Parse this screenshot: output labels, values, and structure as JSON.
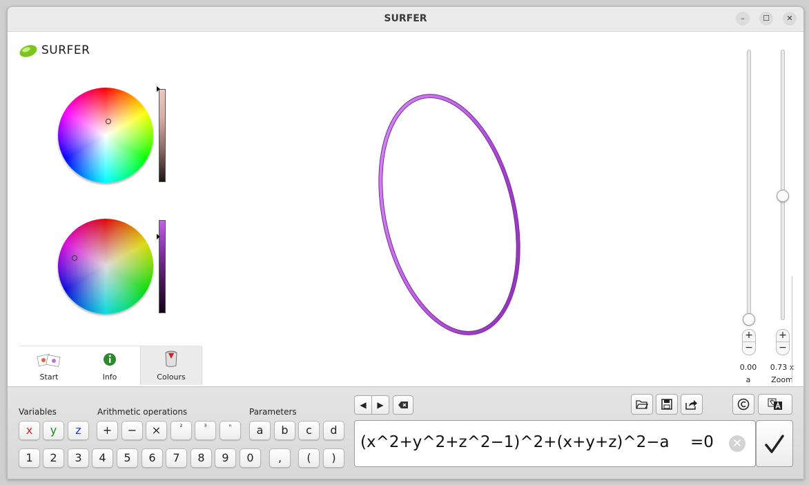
{
  "window": {
    "title": "SURFER"
  },
  "brand": {
    "name": "SURFER"
  },
  "tabs": [
    {
      "label": "Start",
      "icon": "images-icon"
    },
    {
      "label": "Info",
      "icon": "info-icon"
    },
    {
      "label": "Colours",
      "icon": "paint-bucket-icon"
    }
  ],
  "colors": {
    "surface": "#b050d8",
    "inner_bar": "#3a0e3e",
    "outer_bar": "#d8b8b0"
  },
  "sliders": {
    "param": {
      "value": "0.00",
      "label": "a",
      "level": 0.0
    },
    "zoom": {
      "value": "0.73 x",
      "label": "Zoom",
      "level": 0.5
    }
  },
  "keyboard": {
    "variables_label": "Variables",
    "arith_label": "Arithmetic operations",
    "params_label": "Parameters",
    "variables": [
      "x",
      "y",
      "z"
    ],
    "operations": [
      "+",
      "−",
      "×",
      "²",
      "³",
      "ⁿ"
    ],
    "parameters": [
      "a",
      "b",
      "c",
      "d"
    ],
    "digits": [
      "1",
      "2",
      "3",
      "4",
      "5",
      "6",
      "7",
      "8",
      "9",
      "0"
    ],
    "comma": ",",
    "lparen": "(",
    "rparen": ")"
  },
  "formula": {
    "text": "(x^2+y^2+z^2−1)^2+(x+y+z)^2−a",
    "equals": "=0"
  }
}
